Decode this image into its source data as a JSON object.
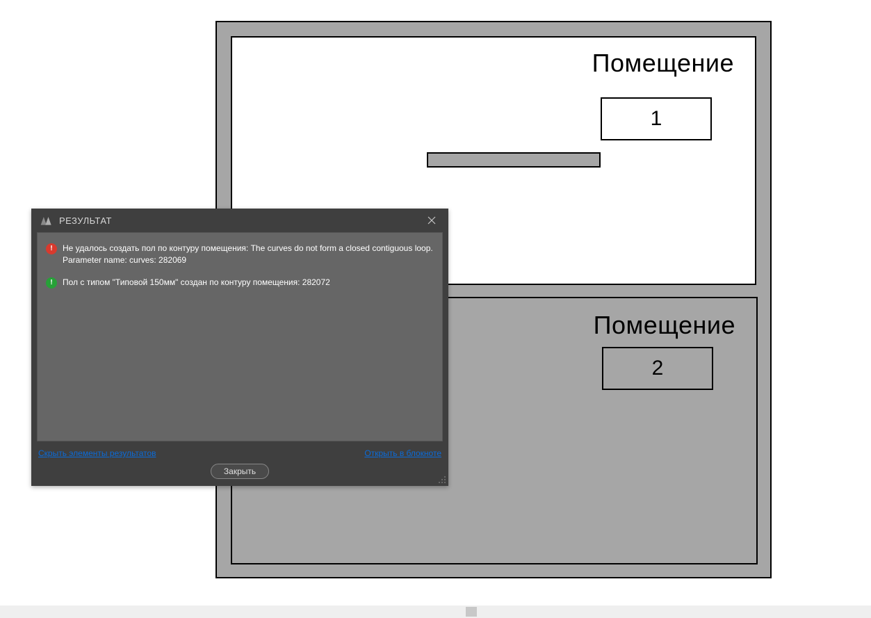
{
  "plan": {
    "rooms": [
      {
        "title": "Помещение",
        "number": "1"
      },
      {
        "title": "Помещение",
        "number": "2"
      }
    ]
  },
  "dialog": {
    "title": "РЕЗУЛЬТАТ",
    "messages": [
      {
        "type": "error",
        "text": "Не удалось создать пол по контуру помещения: The curves do not form a closed contiguous loop.\nParameter name: curves: 282069"
      },
      {
        "type": "success",
        "text": "Пол с типом \"Типовой 150мм\" создан по контуру помещения: 282072"
      }
    ],
    "links": {
      "hide_elements": "Скрыть элементы результатов",
      "open_notepad": "Открыть в блокноте"
    },
    "close_button": "Закрыть"
  }
}
